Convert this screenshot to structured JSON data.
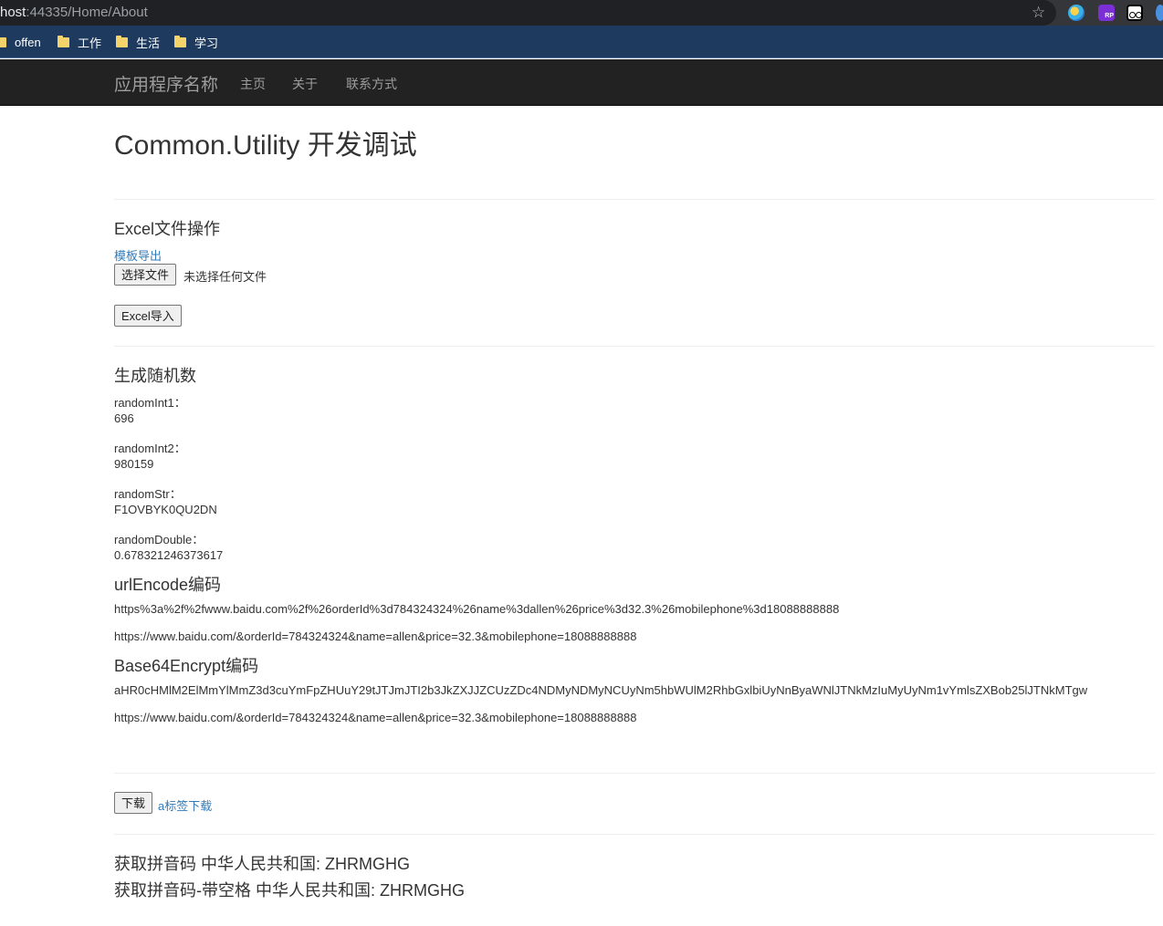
{
  "browser": {
    "url_host": "host",
    "url_path": ":44335/Home/About",
    "bookmarks": [
      "offen",
      "工作",
      "生活",
      "学习"
    ],
    "extension_labels": {
      "rp": "RP"
    }
  },
  "navbar": {
    "brand": "应用程序名称",
    "links": [
      "主页",
      "关于",
      "联系方式"
    ]
  },
  "page": {
    "title": "Common.Utility 开发调试",
    "excel": {
      "heading": "Excel文件操作",
      "export_link": "模板导出",
      "choose_file_button": "选择文件",
      "no_file_text": "未选择任何文件",
      "import_button": "Excel导入"
    },
    "random": {
      "heading": "生成随机数",
      "items": [
        {
          "label": "randomInt1：",
          "value": "696"
        },
        {
          "label": "randomInt2：",
          "value": "980159"
        },
        {
          "label": "randomStr：",
          "value": "F1OVBYK0QU2DN"
        },
        {
          "label": "randomDouble：",
          "value": "0.678321246373617"
        }
      ]
    },
    "urlencode": {
      "heading": "urlEncode编码",
      "encoded": "https%3a%2f%2fwww.baidu.com%2f%26orderId%3d784324324%26name%3dallen%26price%3d32.3%26mobilephone%3d18088888888",
      "decoded": "https://www.baidu.com/&orderId=784324324&name=allen&price=32.3&mobilephone=18088888888"
    },
    "base64": {
      "heading": "Base64Encrypt编码",
      "encoded": "aHR0cHMlM2ElMmYlMmZ3d3cuYmFpZHUuY29tJTJmJTI2b3JkZXJJZCUzZDc4NDMyNDMyNCUyNm5hbWUlM2RhbGxlbiUyNnByaWNlJTNkMzIuMyUyNm1vYmlsZXBob25lJTNkMTgw",
      "decoded": "https://www.baidu.com/&orderId=784324324&name=allen&price=32.3&mobilephone=18088888888"
    },
    "download": {
      "button": "下载",
      "link": "a标签下载"
    },
    "pinyin": {
      "line1": "获取拼音码 中华人民共和国: ZHRMGHG",
      "line2": "获取拼音码-带空格 中华人民共和国: ZHRMGHG"
    }
  }
}
